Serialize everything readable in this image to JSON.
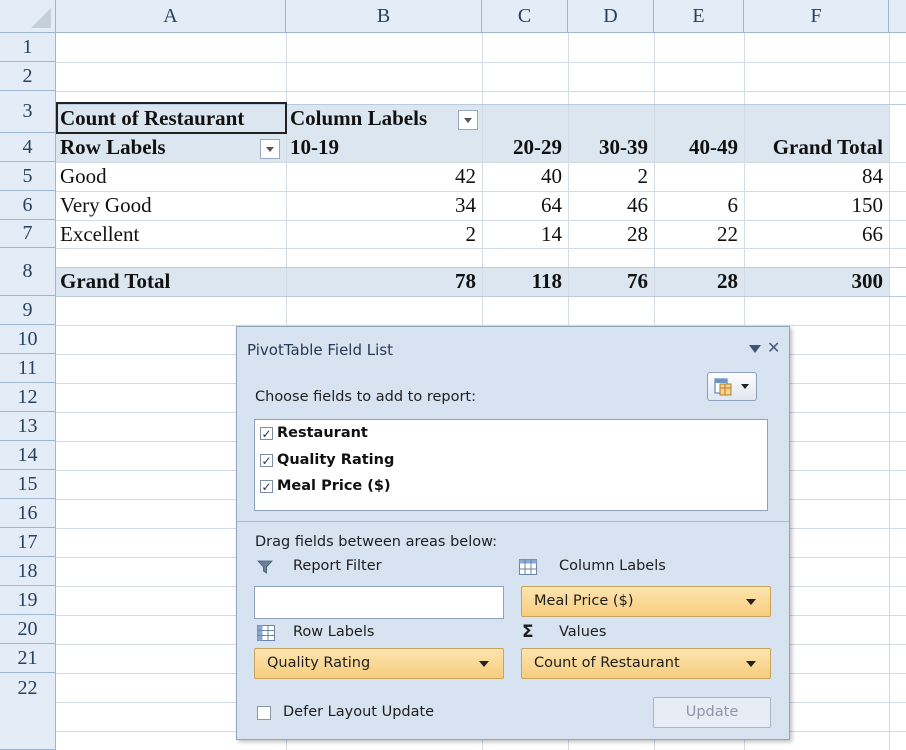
{
  "columns": [
    "A",
    "B",
    "C",
    "D",
    "E",
    "F"
  ],
  "rows": [
    "1",
    "2",
    "3",
    "4",
    "5",
    "6",
    "7",
    "8",
    "9",
    "10",
    "11",
    "12",
    "13",
    "14",
    "15",
    "16",
    "17",
    "18",
    "19",
    "20",
    "21",
    "22"
  ],
  "pivot": {
    "r3": {
      "a": "Count of Restaurant",
      "b": "Column Labels"
    },
    "header": [
      "Row Labels",
      "10-19",
      "20-29",
      "30-39",
      "40-49",
      "Grand Total"
    ],
    "body": [
      [
        "Good",
        "42",
        "40",
        "2",
        "",
        "84"
      ],
      [
        "Very Good",
        "34",
        "64",
        "46",
        "6",
        "150"
      ],
      [
        "Excellent",
        "2",
        "14",
        "28",
        "22",
        "66"
      ]
    ],
    "total": [
      "Grand Total",
      "78",
      "118",
      "76",
      "28",
      "300"
    ]
  },
  "panel": {
    "title": "PivotTable Field List",
    "choose_label": "Choose fields to add to report:",
    "fields": [
      {
        "label": "Restaurant",
        "checked": true
      },
      {
        "label": "Quality Rating",
        "checked": true
      },
      {
        "label": "Meal Price ($)",
        "checked": true
      }
    ],
    "drag_label": "Drag fields between areas below:",
    "report_filter_label": "Report Filter",
    "column_labels_label": "Column Labels",
    "row_labels_label": "Row Labels",
    "values_label": "Values",
    "column_field": "Meal Price ($)",
    "row_field": "Quality Rating",
    "values_field": "Count of Restaurant",
    "defer_label": "Defer Layout Update",
    "update_label": "Update",
    "checkmark": "✓",
    "sigma": "Σ",
    "close_glyph": "✕"
  },
  "colors": {
    "header_bg": "#e4ecf7",
    "pivot_band": "#dce6f1",
    "panel_bg": "#d7e3f1",
    "pill": "#f7cd7d"
  },
  "icons": [
    "filter-icon",
    "column-labels-icon",
    "row-labels-icon",
    "sigma-icon",
    "field-layout-icon",
    "dropdown-arrow-icon",
    "close-icon"
  ]
}
